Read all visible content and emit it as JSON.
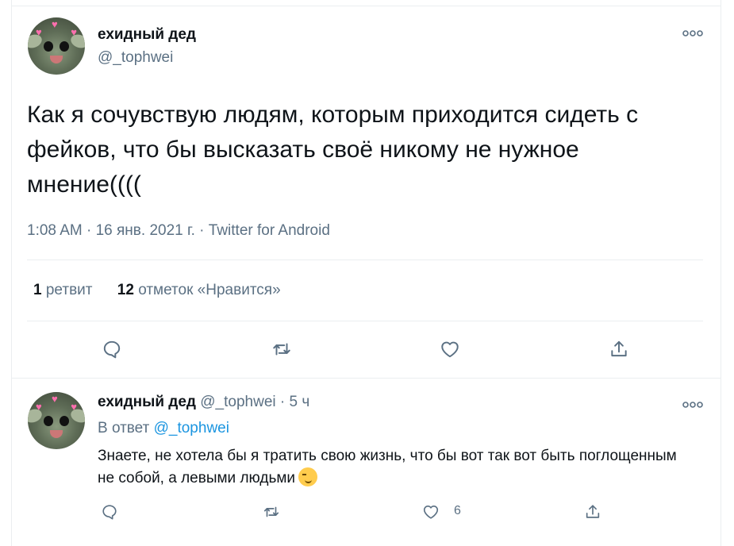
{
  "main_tweet": {
    "display_name": "ехидный дед",
    "handle": "@_tophwei",
    "text": "Как я сочувствую людям, которым приходится сидеть с фейков, что бы высказать своё никому не нужное мнение((((",
    "meta": "1:08 AM · 16 янв. 2021 г. · Twitter for Android",
    "retweets_count": "1",
    "retweets_label": "ретвит",
    "likes_count": "12",
    "likes_label": "отметок «Нравится»",
    "more_icon": "more-icon"
  },
  "reply": {
    "display_name": "ехидный дед",
    "handle": "@_tophwei",
    "separator": "·",
    "time": "5 ч",
    "reply_to_prefix": "В ответ",
    "reply_to_mention": "@_tophwei",
    "text": "Знаете, не хотела бы я тратить свою жизнь, что бы вот так вот быть поглощенным не собой, а левыми людьми",
    "emoji": "smirking-face",
    "like_count": "6"
  },
  "icons": [
    "reply-icon",
    "retweet-icon",
    "like-icon",
    "share-icon",
    "more-icon"
  ],
  "colors": {
    "secondary_text": "#5b7083",
    "link": "#1b95e0",
    "border": "#ebeef0"
  }
}
